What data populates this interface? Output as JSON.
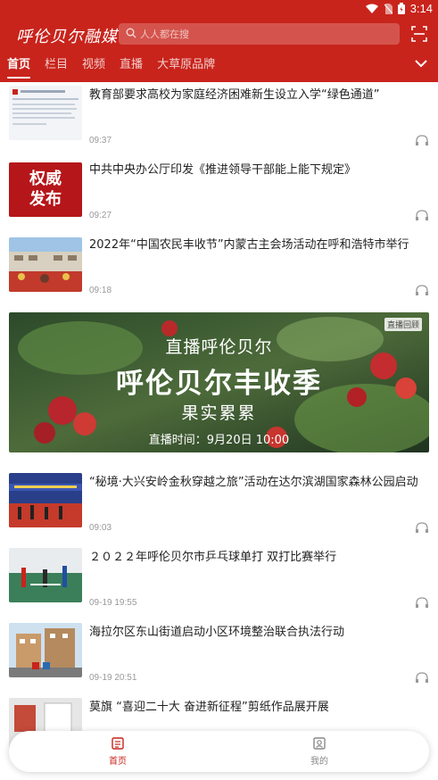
{
  "status_bar": {
    "time": "3:14"
  },
  "header": {
    "logo_text": "呼伦贝尔融媒",
    "search_placeholder": "人人都在搜"
  },
  "tabs": [
    {
      "label": "首页",
      "active": true
    },
    {
      "label": "栏目",
      "active": false
    },
    {
      "label": "视频",
      "active": false
    },
    {
      "label": "直播",
      "active": false
    },
    {
      "label": "大草原品牌",
      "active": false
    }
  ],
  "feed": [
    {
      "title": "教育部要求高校为家庭经济困难新生设立入学“绿色通道”",
      "time": "09:37"
    },
    {
      "title": "中共中央办公厅印发《推进领导干部能上能下规定》",
      "time": "09:27",
      "thumb_text_1": "权威",
      "thumb_text_2": "发布"
    },
    {
      "title": "2022年“中国农民丰收节”内蒙古主会场活动在呼和浩特市举行",
      "time": "09:18"
    },
    {
      "title": "“秘境·大兴安岭金秋穿越之旅”活动在达尔滨湖国家森林公园启动",
      "time": "09:03"
    },
    {
      "title": "２０２２年呼伦贝尔市乒乓球单打 双打比赛举行",
      "time": "09-19 19:55"
    },
    {
      "title": "海拉尔区东山街道启动小区环境整治联合执法行动",
      "time": "09-19 20:51"
    },
    {
      "title": "莫旗 “喜迎二十大 奋进新征程”剪纸作品展开展",
      "time": ""
    }
  ],
  "banner": {
    "tag": "直播回顾",
    "line1": "直播呼伦贝尔",
    "line2": "呼伦贝尔丰收季",
    "line3": "果实累累",
    "line4": "直播时间：9月20日 10:00"
  },
  "bottom_nav": {
    "home_label": "首页",
    "mine_label": "我的"
  },
  "colors": {
    "brand": "#c8241c"
  }
}
